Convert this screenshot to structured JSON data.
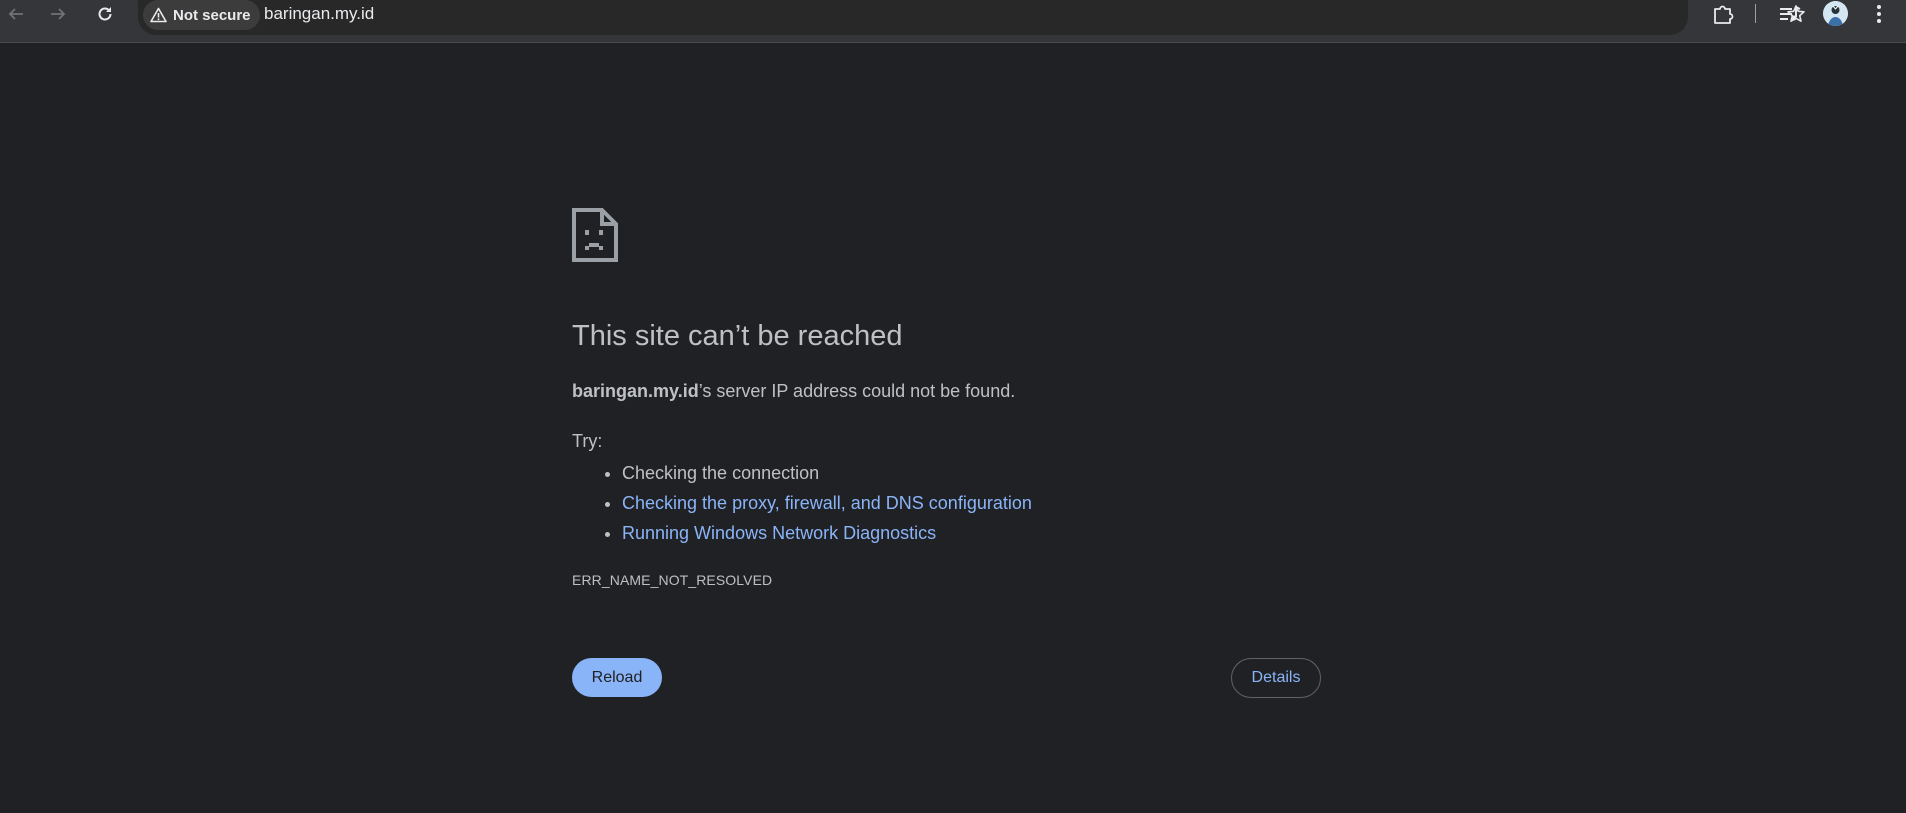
{
  "browser": {
    "security_label": "Not secure",
    "url": "baringan.my.id",
    "icons": [
      "back-icon",
      "forward-icon",
      "reload-icon",
      "warning-icon",
      "star-icon",
      "extensions-icon",
      "reading-list-icon",
      "avatar",
      "menu-icon"
    ]
  },
  "error_page": {
    "icon": "sad-page-icon",
    "title": "This site can’t be reached",
    "summary_host": "baringan.my.id",
    "summary_rest": "’s server IP address could not be found.",
    "try_label": "Try:",
    "suggestions": [
      "Checking the connection",
      "Checking the proxy, firewall, and DNS configuration",
      "Running Windows Network Diagnostics"
    ],
    "error_code": "ERR_NAME_NOT_RESOLVED",
    "reload_label": "Reload",
    "details_label": "Details"
  },
  "colors": {
    "background": "#202124",
    "toolbar": "#35363a",
    "link": "#8ab4f8",
    "text": "#bdc1c6"
  }
}
